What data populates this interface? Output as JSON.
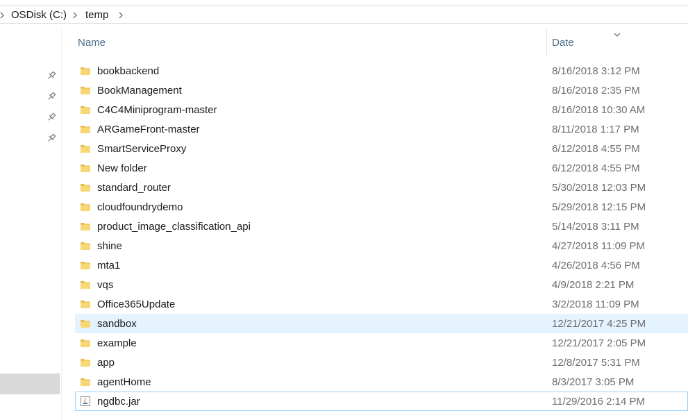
{
  "breadcrumb": {
    "items": [
      "OSDisk (C:)",
      "temp"
    ]
  },
  "columns": {
    "name": "Name",
    "date": "Date"
  },
  "files": [
    {
      "name": "bookbackend",
      "date": "8/16/2018 3:12 PM",
      "type": "folder"
    },
    {
      "name": "BookManagement",
      "date": "8/16/2018 2:35 PM",
      "type": "folder"
    },
    {
      "name": "C4C4Miniprogram-master",
      "date": "8/16/2018 10:30 AM",
      "type": "folder"
    },
    {
      "name": "ARGameFront-master",
      "date": "8/11/2018 1:17 PM",
      "type": "folder"
    },
    {
      "name": "SmartServiceProxy",
      "date": "6/12/2018 4:55 PM",
      "type": "folder"
    },
    {
      "name": "New folder",
      "date": "6/12/2018 4:55 PM",
      "type": "folder"
    },
    {
      "name": "standard_router",
      "date": "5/30/2018 12:03 PM",
      "type": "folder"
    },
    {
      "name": "cloudfoundrydemo",
      "date": "5/29/2018 12:15 PM",
      "type": "folder"
    },
    {
      "name": "product_image_classification_api",
      "date": "5/14/2018 3:11 PM",
      "type": "folder"
    },
    {
      "name": "shine",
      "date": "4/27/2018 11:09 PM",
      "type": "folder"
    },
    {
      "name": "mta1",
      "date": "4/26/2018 4:56 PM",
      "type": "folder"
    },
    {
      "name": "vqs",
      "date": "4/9/2018 2:21 PM",
      "type": "folder"
    },
    {
      "name": "Office365Update",
      "date": "3/2/2018 11:09 PM",
      "type": "folder"
    },
    {
      "name": "sandbox",
      "date": "12/21/2017 4:25 PM",
      "type": "folder",
      "state": "selected"
    },
    {
      "name": "example",
      "date": "12/21/2017 2:05 PM",
      "type": "folder"
    },
    {
      "name": "app",
      "date": "12/8/2017 5:31 PM",
      "type": "folder"
    },
    {
      "name": "agentHome",
      "date": "8/3/2017 3:05 PM",
      "type": "folder"
    },
    {
      "name": "ngdbc.jar",
      "date": "11/29/2016 2:14 PM",
      "type": "jar",
      "state": "focused"
    }
  ],
  "icons": {
    "folder": "folder-icon",
    "jar": "jar-file-icon",
    "pin": "pin-icon",
    "chevron": "chevron-right-icon",
    "sort": "sort-chevron-down-icon"
  },
  "colors": {
    "selection_bg": "#e5f3ff",
    "focus_border": "#99d1ff",
    "header_text": "#4d6c8a",
    "date_text": "#6d6d6d",
    "folder_yellow": "#f8d775"
  }
}
